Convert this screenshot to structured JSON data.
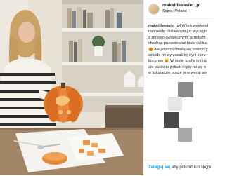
{
  "post": {
    "username": "makelifeeasier_pl",
    "location": "Sopot, Poland",
    "caption_lines": [
      "W ten weekend",
      "naprawdę chciałabym już wyciągn",
      "z zimowo-świątecznymi ozdobam",
      "chodząc pozawieszać białe delikat",
      "🎃 Ale jeszcze chwilę się powstrzy",
      "szkoda mi wyrzucać tej dyni z drz",
      "kocurem 😺 W mojej szafie też trz",
      "ale pasiki to jednak nigdy mi się n",
      "w listopadzie noszę je w wersji we"
    ],
    "footer": {
      "login_label": "Zaloguj się",
      "login_rest": " aby polubić lub skom",
      "more_label": "..."
    }
  },
  "colors": {
    "link": "#0095f6",
    "text": "#262626",
    "pumpkin": "#e0782a",
    "border": "#efefef"
  },
  "icons": [
    "avatar",
    "more-options-icon"
  ]
}
